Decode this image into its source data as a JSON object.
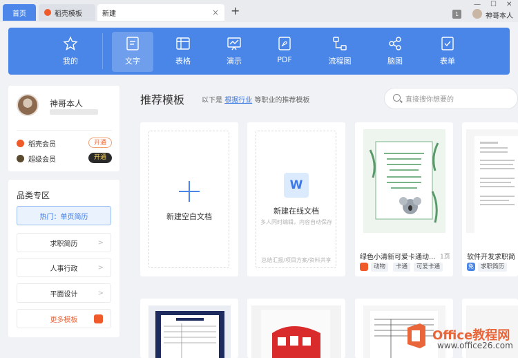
{
  "tabs": [
    {
      "label": "首页"
    },
    {
      "label": "稻壳模板"
    },
    {
      "label": "新建",
      "close": "×"
    }
  ],
  "titlebar": {
    "add_tab": "+",
    "badge": "1",
    "user_name": "神哥本人",
    "min": "—",
    "max": "☐",
    "close": "✕"
  },
  "toolbar": {
    "items": [
      {
        "label": "我的",
        "icon": "star-icon"
      },
      {
        "label": "文字",
        "icon": "document-icon",
        "active": true
      },
      {
        "label": "表格",
        "icon": "table-icon"
      },
      {
        "label": "演示",
        "icon": "presentation-icon"
      },
      {
        "label": "PDF",
        "icon": "pdf-icon"
      },
      {
        "label": "流程图",
        "icon": "flowchart-icon"
      },
      {
        "label": "脑图",
        "icon": "mindmap-icon"
      },
      {
        "label": "表单",
        "icon": "form-icon"
      }
    ]
  },
  "user_card": {
    "name": "神哥本人",
    "memberships": [
      {
        "label": "稻壳会员",
        "action": "开通",
        "color": "#f05a28"
      },
      {
        "label": "超级会员",
        "action": "开通",
        "color": "#5a4a30"
      }
    ]
  },
  "categories": {
    "title": "品类专区",
    "items": [
      {
        "label": "热门：单页简历",
        "selected": true
      },
      {
        "label": "求职简历"
      },
      {
        "label": "人事行政"
      },
      {
        "label": "平面设计"
      },
      {
        "label": "更多模板"
      }
    ]
  },
  "main": {
    "title": "推荐模板",
    "desc_prefix": "以下是",
    "desc_link": "根据行业",
    "desc_suffix": "等职业的推荐模板",
    "search_placeholder": "直接搜你想要的"
  },
  "new_blank": {
    "label": "新建空白文档"
  },
  "new_online": {
    "icon_letter": "W",
    "label": "新建在线文档",
    "sub": "多人同时编辑，内容自动保存",
    "footer": "总结汇报/项目方案/资料共享"
  },
  "templates": [
    {
      "name": "绿色小清新可爱卡通动...",
      "pages": "1页",
      "tags": [
        "动物",
        "卡通",
        "可爱卡通"
      ]
    },
    {
      "name": "软件开发求职简",
      "tags": [
        "求职简历"
      ],
      "logo_text": "免"
    }
  ],
  "watermark": {
    "brand": "Office教程网",
    "url": "www.office26.com"
  }
}
